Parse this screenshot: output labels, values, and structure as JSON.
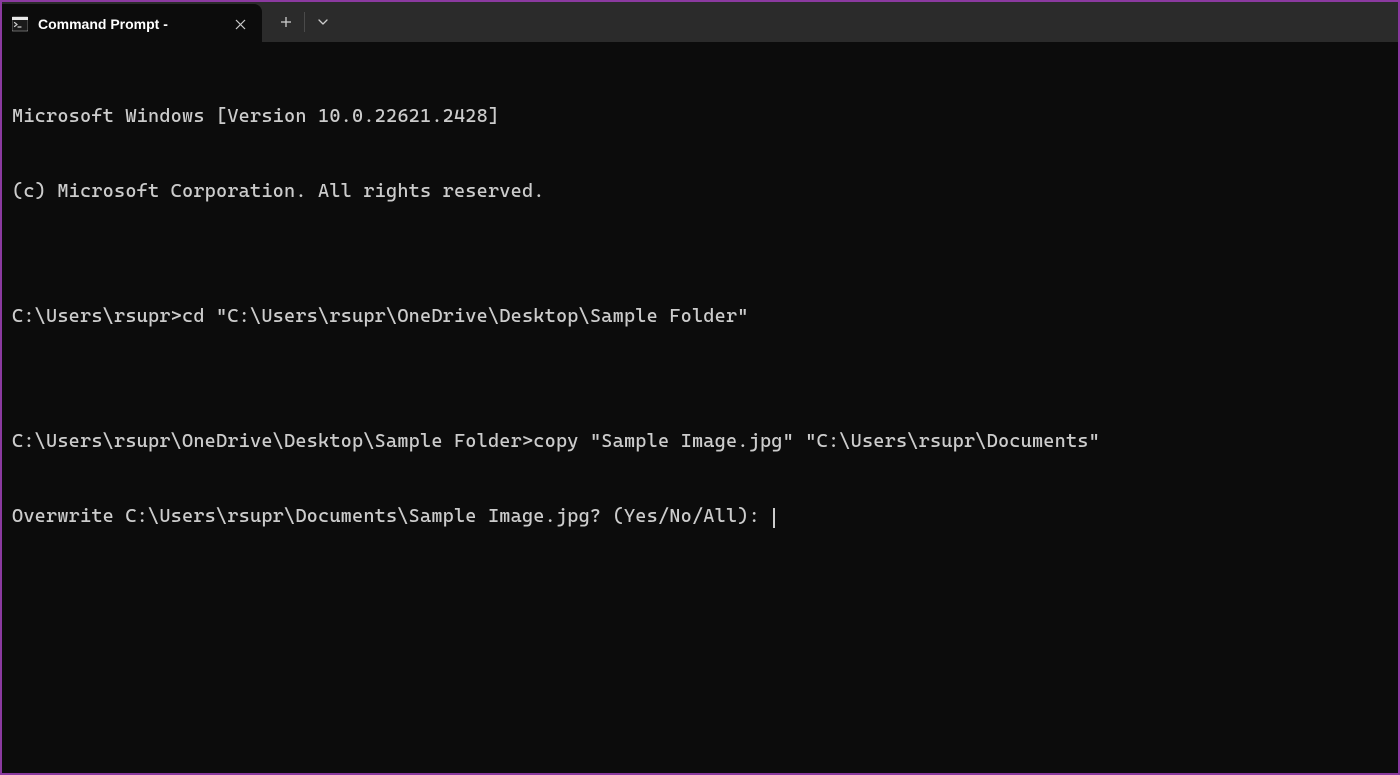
{
  "tab": {
    "title": "Command Prompt -"
  },
  "terminal": {
    "line1": "Microsoft Windows [Version 10.0.22621.2428]",
    "line2": "(c) Microsoft Corporation. All rights reserved.",
    "blank1": "",
    "line3": "C:\\Users\\rsupr>cd \"C:\\Users\\rsupr\\OneDrive\\Desktop\\Sample Folder\"",
    "blank2": "",
    "line4": "C:\\Users\\rsupr\\OneDrive\\Desktop\\Sample Folder>copy \"Sample Image.jpg\" \"C:\\Users\\rsupr\\Documents\"",
    "line5": "Overwrite C:\\Users\\rsupr\\Documents\\Sample Image.jpg? (Yes/No/All): "
  }
}
